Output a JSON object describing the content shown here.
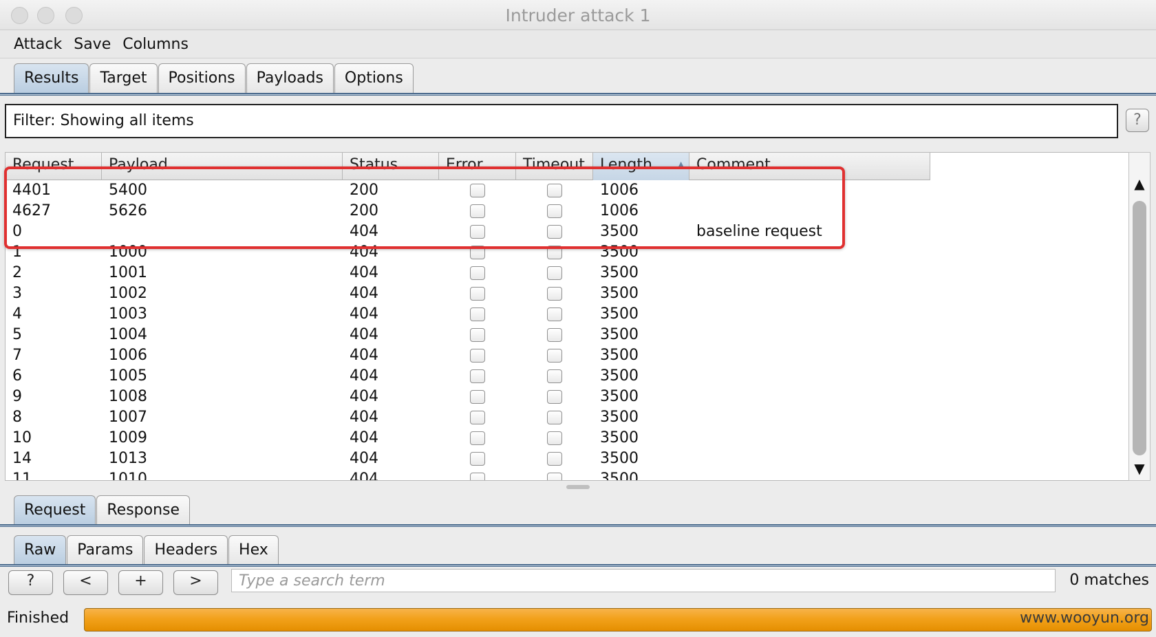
{
  "window": {
    "title": "Intruder attack 1"
  },
  "menu": [
    "Attack",
    "Save",
    "Columns"
  ],
  "top_tabs": [
    {
      "label": "Results",
      "active": true
    },
    {
      "label": "Target",
      "active": false
    },
    {
      "label": "Positions",
      "active": false
    },
    {
      "label": "Payloads",
      "active": false
    },
    {
      "label": "Options",
      "active": false
    }
  ],
  "filter": {
    "text": "Filter: Showing all items",
    "help_label": "?"
  },
  "table": {
    "columns": [
      "Request",
      "Payload",
      "Status",
      "Error",
      "Timeout",
      "Length",
      "Comment"
    ],
    "sorted_column": "Length",
    "sort_indicator": "▲",
    "rows": [
      {
        "request": "4401",
        "payload": "5400",
        "status": "200",
        "length": "1006",
        "comment": ""
      },
      {
        "request": "4627",
        "payload": "5626",
        "status": "200",
        "length": "1006",
        "comment": ""
      },
      {
        "request": "0",
        "payload": "",
        "status": "404",
        "length": "3500",
        "comment": "baseline request"
      },
      {
        "request": "1",
        "payload": "1000",
        "status": "404",
        "length": "3500",
        "comment": ""
      },
      {
        "request": "2",
        "payload": "1001",
        "status": "404",
        "length": "3500",
        "comment": ""
      },
      {
        "request": "3",
        "payload": "1002",
        "status": "404",
        "length": "3500",
        "comment": ""
      },
      {
        "request": "4",
        "payload": "1003",
        "status": "404",
        "length": "3500",
        "comment": ""
      },
      {
        "request": "5",
        "payload": "1004",
        "status": "404",
        "length": "3500",
        "comment": ""
      },
      {
        "request": "7",
        "payload": "1006",
        "status": "404",
        "length": "3500",
        "comment": ""
      },
      {
        "request": "6",
        "payload": "1005",
        "status": "404",
        "length": "3500",
        "comment": ""
      },
      {
        "request": "9",
        "payload": "1008",
        "status": "404",
        "length": "3500",
        "comment": ""
      },
      {
        "request": "8",
        "payload": "1007",
        "status": "404",
        "length": "3500",
        "comment": ""
      },
      {
        "request": "10",
        "payload": "1009",
        "status": "404",
        "length": "3500",
        "comment": ""
      },
      {
        "request": "14",
        "payload": "1013",
        "status": "404",
        "length": "3500",
        "comment": ""
      },
      {
        "request": "11",
        "payload": "1010",
        "status": "404",
        "length": "3500",
        "comment": ""
      }
    ]
  },
  "scrollbar": {
    "up": "▲",
    "down": "▼"
  },
  "message_tabs": [
    {
      "label": "Request",
      "active": true
    },
    {
      "label": "Response",
      "active": false
    }
  ],
  "view_tabs": [
    {
      "label": "Raw",
      "active": true
    },
    {
      "label": "Params",
      "active": false
    },
    {
      "label": "Headers",
      "active": false
    },
    {
      "label": "Hex",
      "active": false
    }
  ],
  "search": {
    "help_label": "?",
    "prev_label": "<",
    "add_label": "+",
    "next_label": ">",
    "placeholder": "Type a search term",
    "matches": "0 matches"
  },
  "status": {
    "text": "Finished",
    "progress": 1.0,
    "watermark": "www.wooyun.org"
  },
  "colors": {
    "highlight": "#e03030",
    "progress": "#f2a11b",
    "active_tab": "#c3d4e6"
  }
}
